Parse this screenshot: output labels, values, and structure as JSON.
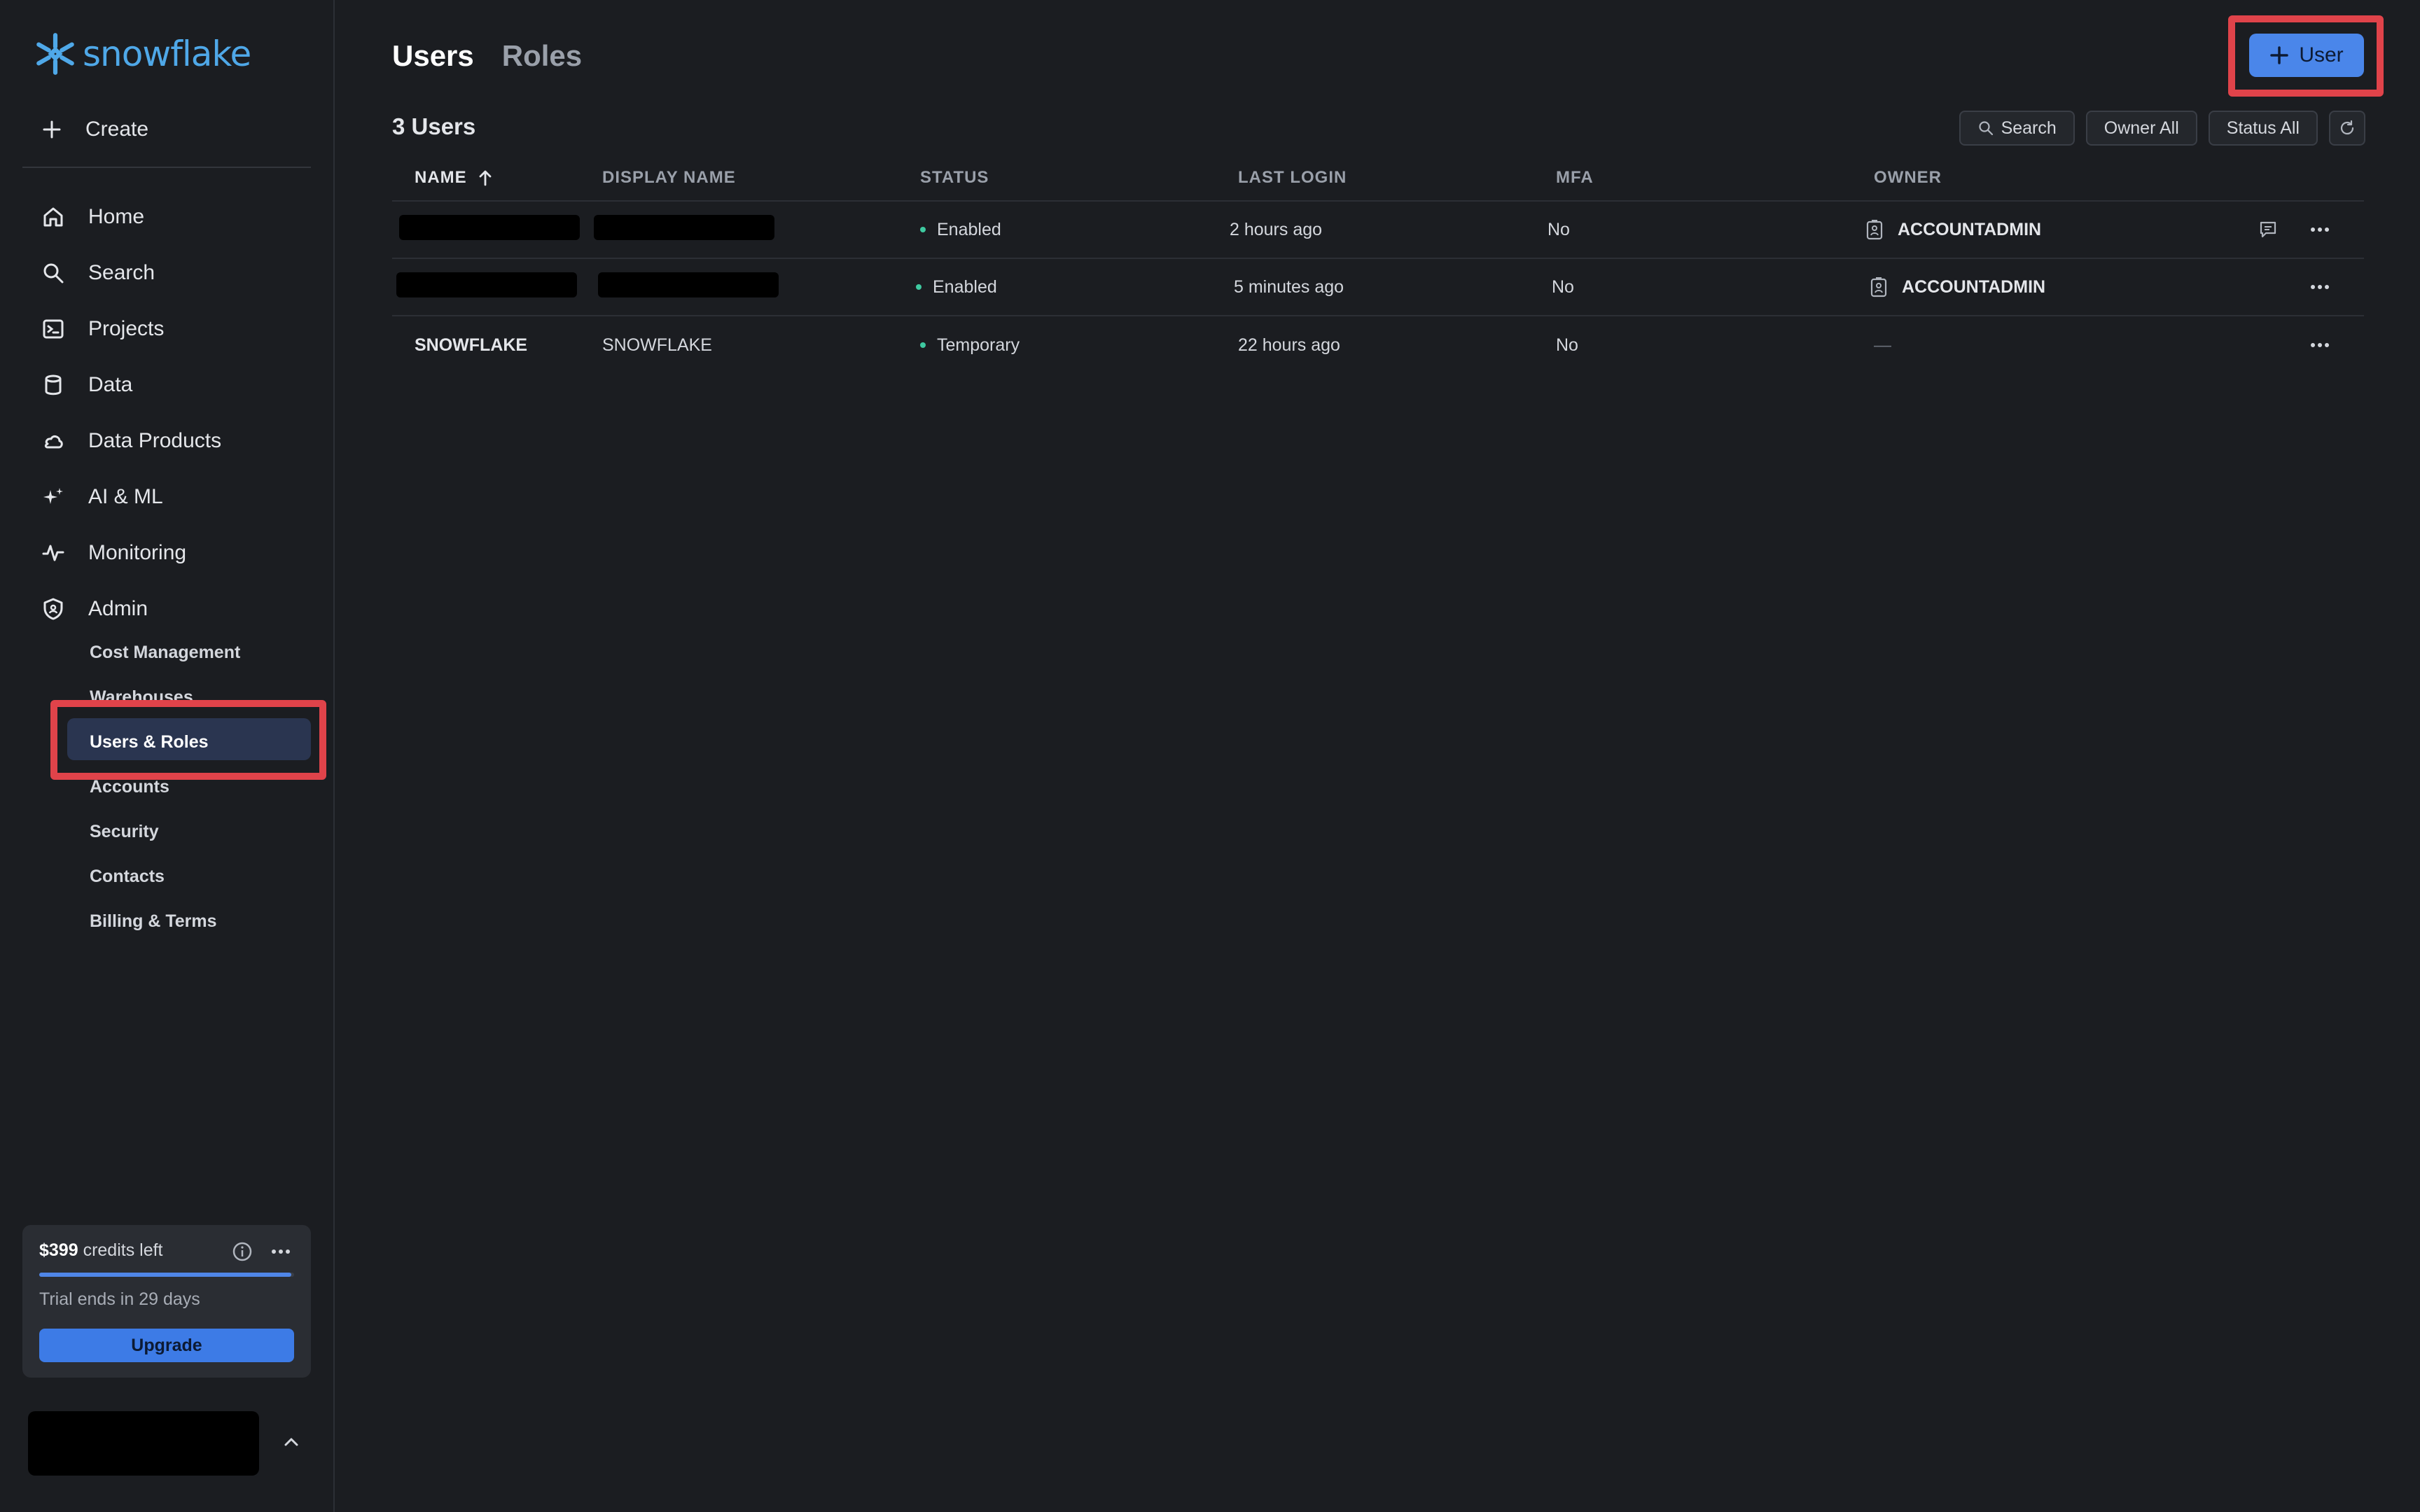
{
  "app": {
    "brand": "snowflake",
    "accent": "#4a86ea",
    "highlight": "#e0434a"
  },
  "sidebar": {
    "create_label": "Create",
    "nav": [
      {
        "label": "Home",
        "icon": "home-icon"
      },
      {
        "label": "Search",
        "icon": "search-icon"
      },
      {
        "label": "Projects",
        "icon": "terminal-icon"
      },
      {
        "label": "Data",
        "icon": "database-icon"
      },
      {
        "label": "Data Products",
        "icon": "cloud-icon"
      },
      {
        "label": "AI & ML",
        "icon": "sparkle-icon"
      },
      {
        "label": "Monitoring",
        "icon": "activity-icon"
      },
      {
        "label": "Admin",
        "icon": "shield-icon"
      }
    ],
    "admin_sub": [
      {
        "label": "Cost Management"
      },
      {
        "label": "Warehouses"
      },
      {
        "label": "Users & Roles",
        "active": true
      },
      {
        "label": "Accounts"
      },
      {
        "label": "Security"
      },
      {
        "label": "Contacts"
      },
      {
        "label": "Billing & Terms"
      }
    ],
    "credits": {
      "amount": "$399",
      "suffix": "credits left",
      "progress": 0.99,
      "trial_text": "Trial ends in 29 days",
      "upgrade_label": "Upgrade"
    }
  },
  "main": {
    "tabs": [
      {
        "label": "Users",
        "active": true
      },
      {
        "label": "Roles",
        "active": false
      }
    ],
    "add_user_label": "User",
    "count_label": "3 Users",
    "filters": {
      "search": "Search",
      "owner": "Owner All",
      "status": "Status All"
    },
    "columns": [
      "NAME",
      "DISPLAY NAME",
      "STATUS",
      "LAST LOGIN",
      "MFA",
      "OWNER"
    ],
    "rows": [
      {
        "name": "",
        "display": "",
        "status": "Enabled",
        "last_login": "2 hours ago",
        "mfa": "No",
        "owner": "ACCOUNTADMIN",
        "redacted": true,
        "comment": true
      },
      {
        "name": "",
        "display": "",
        "status": "Enabled",
        "last_login": "5 minutes ago",
        "mfa": "No",
        "owner": "ACCOUNTADMIN",
        "redacted": true,
        "comment": false
      },
      {
        "name": "SNOWFLAKE",
        "display": "SNOWFLAKE",
        "status": "Temporary",
        "last_login": "22 hours ago",
        "mfa": "No",
        "owner": "—",
        "redacted": false,
        "comment": false
      }
    ]
  }
}
